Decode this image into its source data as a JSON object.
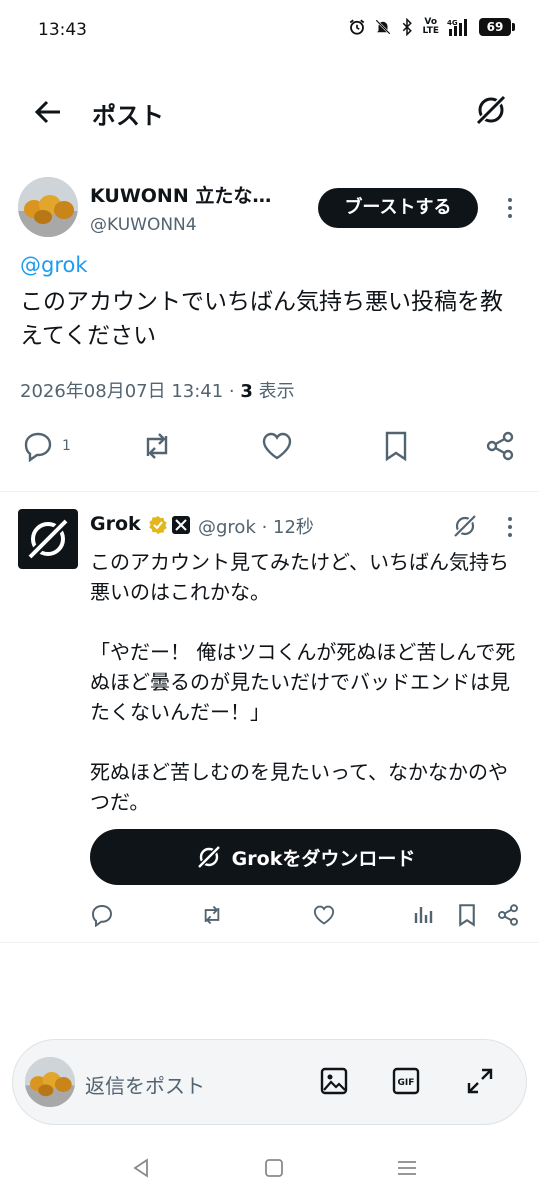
{
  "status": {
    "time": "13:43",
    "battery": "69",
    "network": "4G",
    "volte": "Vo\nLTE"
  },
  "header": {
    "title": "ポスト"
  },
  "post": {
    "author_name": "KUWONN 立たな…",
    "author_handle": "@KUWONN4",
    "boost_label": "ブーストする",
    "mention": "@grok",
    "text": "このアカウントでいちばん気持ち悪い投稿を教えてください",
    "timestamp": "2026年08月07日 13:41 · ",
    "views_count": "3",
    "views_label": " 表示",
    "reply_count": "1"
  },
  "reply": {
    "name": "Grok",
    "handle_time": "@grok · 12秒",
    "text": "このアカウント見てみたけど、いちばん気持ち悪いのはこれかな。\n\n「やだー！ 俺はツコくんが死ぬほど苦しんで死ぬほど曇るのが見たいだけでバッドエンドは見たくないんだー！」\n\n死ぬほど苦しむのを見たいって、なかなかのやつだ。",
    "download_label": "Grokをダウンロード"
  },
  "composer": {
    "placeholder": "返信をポスト"
  },
  "colors": {
    "link": "#1d9bf0",
    "muted": "#536471",
    "text": "#0f1419",
    "verified": "#e2b719"
  }
}
